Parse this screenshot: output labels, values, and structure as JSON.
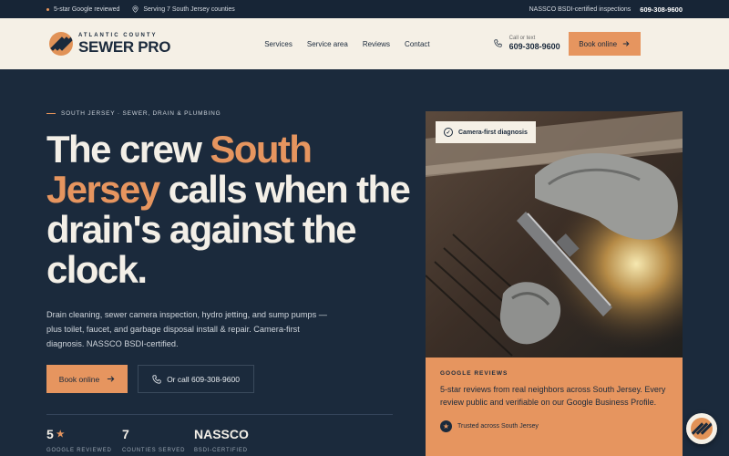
{
  "topbar": {
    "reviews": "5-star Google reviewed",
    "serving": "Serving 7 South Jersey counties",
    "certified": "NASSCO BSDI-certified inspections",
    "phone": "609-308-9600"
  },
  "header": {
    "logo_small": "ATLANTIC COUNTY",
    "logo_big": "SEWER PRO",
    "nav": [
      "Services",
      "Service area",
      "Reviews",
      "Contact"
    ],
    "call_label": "Call or text",
    "call_number": "609-308-9600",
    "book_label": "Book online"
  },
  "hero": {
    "eyebrow": "SOUTH JERSEY · SEWER, DRAIN & PLUMBING",
    "headline_pre": "The crew ",
    "headline_accent": "South Jersey",
    "headline_post": " calls when the drain's against the clock.",
    "description": "Drain cleaning, sewer camera inspection, hydro jetting, and sump pumps — plus toilet, faucet, and garbage disposal install & repair. Camera-first diagnosis. NASSCO BSDI-certified.",
    "book_label": "Book online",
    "call_label": "Or call 609-308-9600",
    "stats": [
      {
        "value": "5",
        "label": "GOOGLE REVIEWED"
      },
      {
        "value": "7",
        "label": "COUNTIES SERVED"
      },
      {
        "value": "NASSCO",
        "label": "BSDI-CERTIFIED"
      }
    ]
  },
  "photo": {
    "badge": "Camera-first diagnosis"
  },
  "review_card": {
    "eyebrow": "GOOGLE REVIEWS",
    "text": "5-star reviews from real neighbors across South Jersey. Every review public and verifiable on our Google Business Profile.",
    "trust": "Trusted across South Jersey"
  },
  "colors": {
    "navy": "#1b2a3c",
    "accent": "#e6955f",
    "cream": "#f5f0e6"
  },
  "icons": {
    "location": "map-pin-icon",
    "phone": "phone-icon",
    "arrow": "arrow-right-icon",
    "check": "check-circle-icon",
    "star": "star-icon"
  }
}
